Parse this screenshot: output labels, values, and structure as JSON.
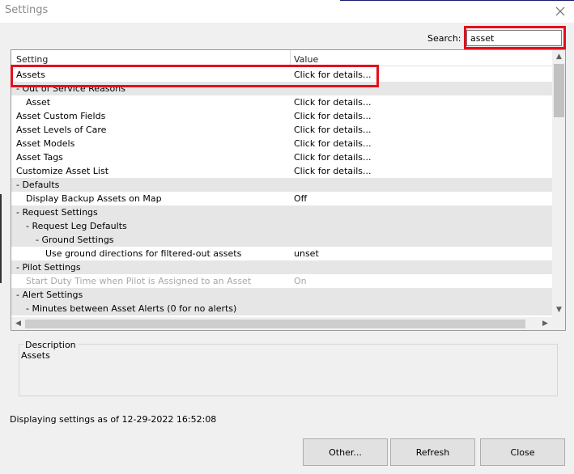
{
  "window": {
    "title": "Settings",
    "close_icon": "close-icon"
  },
  "search": {
    "label": "Search:",
    "value": "asset"
  },
  "grid": {
    "columns": [
      "Setting",
      "Value"
    ],
    "rows": [
      {
        "setting": "Assets",
        "value": "Click for details...",
        "indent": 0,
        "section": false,
        "disabled": false
      },
      {
        "setting": "- Out of Service Reasons",
        "value": "",
        "indent": 0,
        "section": true,
        "disabled": false
      },
      {
        "setting": "Asset",
        "value": "Click for details...",
        "indent": 1,
        "section": false,
        "disabled": false
      },
      {
        "setting": "Asset Custom Fields",
        "value": "Click for details...",
        "indent": 0,
        "section": false,
        "disabled": false
      },
      {
        "setting": "Asset Levels of Care",
        "value": "Click for details...",
        "indent": 0,
        "section": false,
        "disabled": false
      },
      {
        "setting": "Asset Models",
        "value": "Click for details...",
        "indent": 0,
        "section": false,
        "disabled": false
      },
      {
        "setting": "Asset Tags",
        "value": "Click for details...",
        "indent": 0,
        "section": false,
        "disabled": false
      },
      {
        "setting": "Customize Asset List",
        "value": "Click for details...",
        "indent": 0,
        "section": false,
        "disabled": false
      },
      {
        "setting": "- Defaults",
        "value": "",
        "indent": 0,
        "section": true,
        "disabled": false
      },
      {
        "setting": "Display Backup Assets on Map",
        "value": "Off",
        "indent": 1,
        "section": false,
        "disabled": false
      },
      {
        "setting": "- Request Settings",
        "value": "",
        "indent": 0,
        "section": true,
        "disabled": false
      },
      {
        "setting": "- Request Leg Defaults",
        "value": "",
        "indent": 1,
        "section": true,
        "disabled": false
      },
      {
        "setting": "- Ground Settings",
        "value": "",
        "indent": 2,
        "section": true,
        "disabled": false
      },
      {
        "setting": "Use ground directions for filtered-out assets",
        "value": "unset",
        "indent": 3,
        "section": false,
        "disabled": false
      },
      {
        "setting": "- Pilot Settings",
        "value": "",
        "indent": 0,
        "section": true,
        "disabled": false
      },
      {
        "setting": "Start Duty Time when Pilot is Assigned to an Asset",
        "value": "On",
        "indent": 1,
        "section": false,
        "disabled": true
      },
      {
        "setting": "- Alert Settings",
        "value": "",
        "indent": 0,
        "section": true,
        "disabled": false
      },
      {
        "setting": "- Minutes between Asset Alerts (0 for no alerts)",
        "value": "",
        "indent": 1,
        "section": true,
        "disabled": false
      }
    ]
  },
  "description": {
    "legend": "Description",
    "text": "Assets"
  },
  "status": {
    "text": "Displaying settings as of 12-29-2022 16:52:08"
  },
  "buttons": {
    "other": "Other...",
    "refresh": "Refresh",
    "close": "Close"
  },
  "colors": {
    "highlight": "#e3101e",
    "section_bg": "#e6e6e6",
    "disabled_text": "#a8a8a8"
  }
}
